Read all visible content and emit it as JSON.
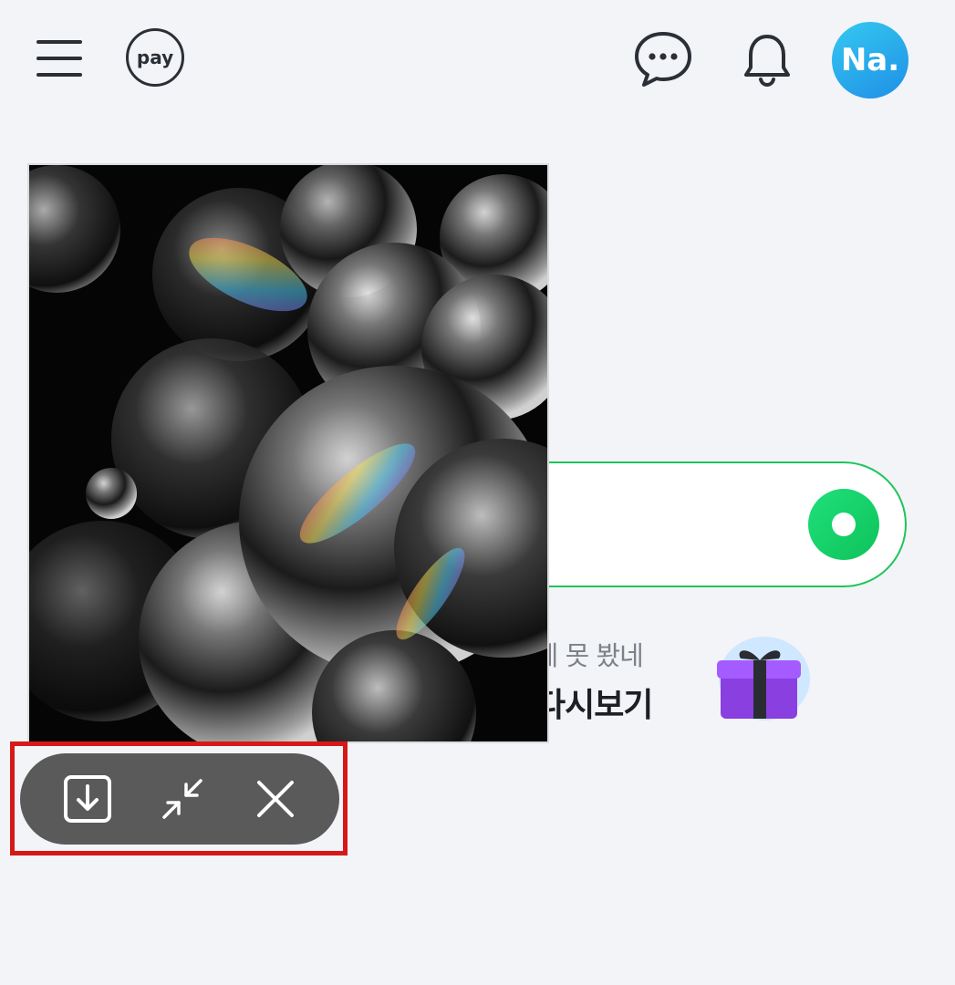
{
  "header": {
    "pay_label": "pay",
    "avatar_text": "Na."
  },
  "promo": {
    "subtitle": "던데 못 봤네",
    "title": "! 다시보기"
  },
  "player": {
    "icons": [
      "download-icon",
      "minimize-icon",
      "close-icon"
    ]
  },
  "colors": {
    "background": "#f2f4f7",
    "accent_green": "#1ec55a",
    "avatar_blue": "#1f8fe6",
    "control_bar": "#5a5a5a",
    "highlight_red": "#d61818"
  }
}
